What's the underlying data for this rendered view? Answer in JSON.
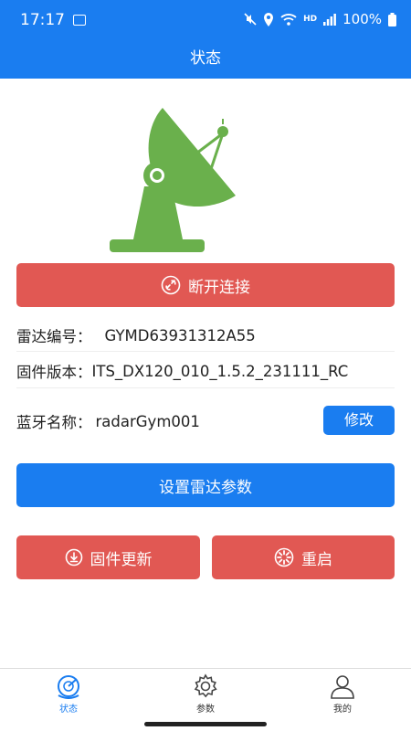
{
  "status_bar": {
    "time": "17:17",
    "battery": "100%",
    "network_label": "HD"
  },
  "header": {
    "title": "状态"
  },
  "device": {
    "disconnect_label": "断开连接",
    "radar_id_label": "雷达编号：",
    "radar_id_value": "GYMD63931312A55",
    "firmware_label": "固件版本：",
    "firmware_value": "ITS_DX120_010_1.5.2_231111_RC",
    "bluetooth_label": "蓝牙名称：",
    "bluetooth_value": "radarGym001",
    "edit_label": "修改"
  },
  "actions": {
    "set_params_label": "设置雷达参数",
    "firmware_update_label": "固件更新",
    "restart_label": "重启"
  },
  "tabs": [
    {
      "label": "状态",
      "icon": "radar-status-icon",
      "active": true
    },
    {
      "label": "参数",
      "icon": "gear-icon",
      "active": false
    },
    {
      "label": "我的",
      "icon": "user-icon",
      "active": false
    }
  ],
  "colors": {
    "primary": "#1a7df0",
    "danger": "#e15853",
    "radar_green": "#6ab04c"
  }
}
